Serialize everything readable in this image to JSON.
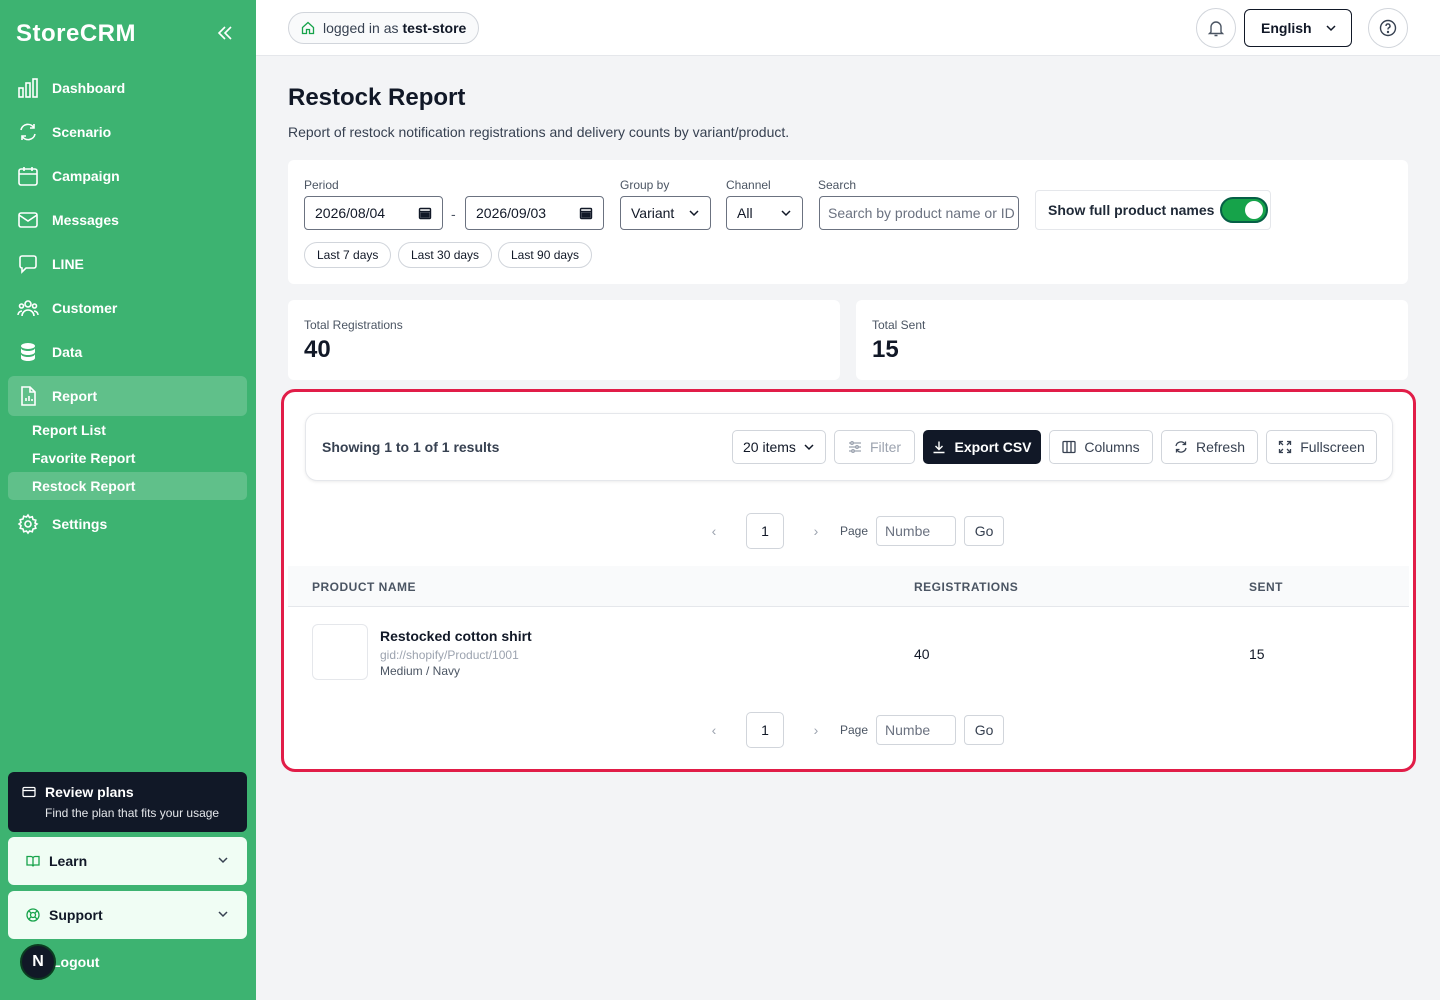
{
  "sidebar": {
    "brand": "StoreCRM",
    "nav": [
      {
        "label": "Dashboard",
        "icon": "bar-chart-icon"
      },
      {
        "label": "Scenario",
        "icon": "refresh-cycle-icon"
      },
      {
        "label": "Campaign",
        "icon": "calendar-icon"
      },
      {
        "label": "Messages",
        "icon": "mail-icon"
      },
      {
        "label": "LINE",
        "icon": "chat-icon"
      },
      {
        "label": "Customer",
        "icon": "users-icon"
      },
      {
        "label": "Data",
        "icon": "database-icon"
      },
      {
        "label": "Report",
        "icon": "report-icon"
      },
      {
        "label": "Settings",
        "icon": "gear-icon"
      }
    ],
    "report_sub": [
      "Report List",
      "Favorite Report",
      "Restock Report"
    ],
    "plans": {
      "title": "Review plans",
      "subtitle": "Find the plan that fits your usage"
    },
    "learn": "Learn",
    "support": "Support",
    "logout": "Logout",
    "avatar_letter": "N"
  },
  "topbar": {
    "logged_prefix": "logged in as",
    "store": "test-store",
    "language": "English"
  },
  "page": {
    "title": "Restock Report",
    "description": "Report of restock notification registrations and delivery counts by variant/product."
  },
  "filters": {
    "period_label": "Period",
    "date_from": "2026/08/04",
    "separator": "-",
    "date_to": "2026/09/03",
    "group_label": "Group by",
    "group_value": "Variant",
    "channel_label": "Channel",
    "channel_value": "All",
    "search_label": "Search",
    "search_placeholder": "Search by product name or ID",
    "toggle_label": "Show full product names",
    "toggle_on": true,
    "quick": [
      "Last 7 days",
      "Last 30 days",
      "Last 90 days"
    ]
  },
  "stats": {
    "registrations_label": "Total Registrations",
    "registrations_value": "40",
    "sent_label": "Total Sent",
    "sent_value": "15"
  },
  "results": {
    "showing": "Showing 1 to 1 of 1 results",
    "page_size": "20 items",
    "filter": "Filter",
    "export": "Export CSV",
    "columns": "Columns",
    "refresh": "Refresh",
    "fullscreen": "Fullscreen",
    "pager": {
      "current": "1",
      "page_label": "Page",
      "input_placeholder": "Numbe",
      "go": "Go"
    },
    "headers": [
      "PRODUCT NAME",
      "REGISTRATIONS",
      "SENT"
    ],
    "rows": [
      {
        "name": "Restocked cotton shirt",
        "id": "gid://shopify/Product/1001",
        "variant": "Medium / Navy",
        "registrations": "40",
        "sent": "15"
      }
    ]
  },
  "colors": {
    "sidebar": "#3db371",
    "dark": "#111827",
    "highlight": "#e11d48",
    "toggle": "#16a34a"
  }
}
